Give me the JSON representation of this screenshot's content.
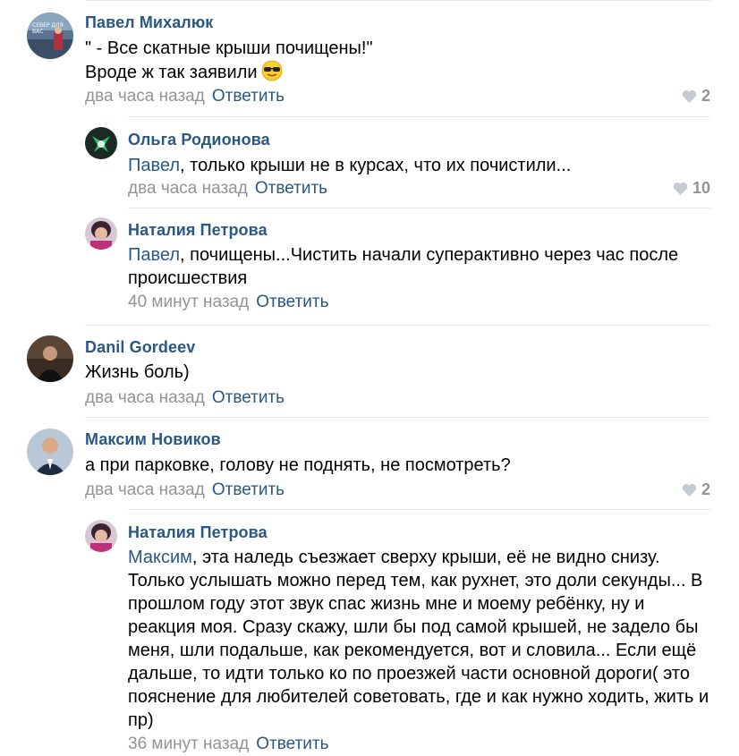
{
  "comments": [
    {
      "author": "Павел Михалюк",
      "text_line1": "\" - Все скатные крыши почищены!\"",
      "text_line2": "Вроде ж так заявили",
      "time": "два часа назад",
      "reply": "Ответить",
      "likes": "2"
    },
    {
      "author": "Ольга Родионова",
      "mention": "Павел",
      "text": ", только крыши не в курсах, что их почистили...",
      "time": "два часа назад",
      "reply": "Ответить",
      "likes": "10"
    },
    {
      "author": "Наталия Петрова",
      "mention": "Павел",
      "text_line1": ", почищены...Чистить начали суперактивно через час после",
      "text_line2": "происшествия",
      "time": "40 минут назад",
      "reply": "Ответить"
    },
    {
      "author": "Danil Gordeev",
      "text": "Жизнь боль)",
      "time": "два часа назад",
      "reply": "Ответить"
    },
    {
      "author": "Максим Новиков",
      "text": "а при парковке, голову не поднять, не посмотреть?",
      "time": "два часа назад",
      "reply": "Ответить",
      "likes": "2"
    },
    {
      "author": "Наталия Петрова",
      "mention": "Максим",
      "lines": [
        ", эта наледь съезжает сверху крыши, её не видно снизу.",
        "Только услышать можно перед тем, как рухнет, это доли секунды... В",
        "прошлом году этот звук спас жизнь мне и моему ребёнку, ну и",
        "реакция моя. Сразу скажу, шли бы под самой крышей, не задело бы",
        "меня, шли подальше, как рекомендуется, вот и словила... Если ещё",
        "дальше, то идти только ко по проезжей части основной дороги( это",
        "пояснение для любителей советовать, где и как нужно ходить, жить и",
        "пр)"
      ],
      "time": "36 минут назад",
      "reply": "Ответить"
    }
  ],
  "icons": {
    "emoji": "sunglasses-emoji-icon",
    "like": "heart-icon"
  },
  "colors": {
    "link": "#2a5885",
    "meta": "#939393",
    "separator": "#e7e8ec"
  }
}
